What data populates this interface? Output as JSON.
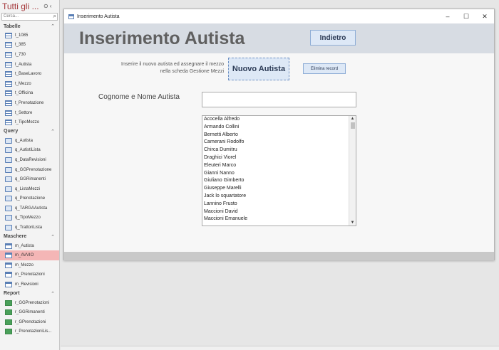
{
  "nav": {
    "title": "Tutti gli ...",
    "search_placeholder": "Cerca...",
    "groups": [
      {
        "label": "Tabelle",
        "items": [
          "t_1085",
          "t_385",
          "t_730",
          "t_Autista",
          "t_BaseLavoro",
          "t_Mezzo",
          "t_Officina",
          "t_Prenotazione",
          "t_Settore",
          "t_TipoMezzo"
        ]
      },
      {
        "label": "Query",
        "items": [
          "q_Autista",
          "q_AutistiLista",
          "q_DataRevisioni",
          "q_GGPrenotazione",
          "q_GGRimanenti",
          "q_ListaMezzi",
          "q_Prenotazione",
          "q_TARGAAutista",
          "q_TipoMezzo",
          "q_TrattoriLista"
        ]
      },
      {
        "label": "Maschere",
        "items": [
          "m_Autista",
          "m_AVVIO",
          "m_Mezzo",
          "m_Prenotazioni",
          "m_Revisioni"
        ],
        "selected": "m_AVVIO"
      },
      {
        "label": "Report",
        "items": [
          "r_GGPrenotazioni",
          "r_GGRimanenti",
          "r_GPrenotazioni",
          "r_PrenotazioniLis..."
        ]
      }
    ]
  },
  "window": {
    "title": "Inserimento Autista",
    "controls": [
      "–",
      "☐",
      "✕"
    ]
  },
  "form": {
    "title": "Inserimento Autista",
    "back_label": "Indietro",
    "hint": "Inserire il nuovo autista ed assegnare il mezzo nella scheda Gestione Mezzi",
    "new_label": "Nuovo Autista",
    "delete_label": "Elimina record",
    "name_label": "Cognome e Nome Autista",
    "name_value": "",
    "list": [
      "Acocella Alfredo",
      "Armando Collini",
      "Bernetti Alberto",
      "Camerani Rodolfo",
      "Chirca Dumitru",
      "Draghici Viorel",
      "Eleuteri Marco",
      "Gianni Nanno",
      "Giuliano Gimberto",
      "Giuseppe Marelli",
      "Jack lo squartatore",
      "Lannino Frusto",
      "Maccioni David",
      "Maccioni Emanuele"
    ]
  },
  "colors": {
    "nav_title": "#a4373a",
    "selected_item": "#f4b6b6",
    "button_bg": "#dde8f6"
  }
}
